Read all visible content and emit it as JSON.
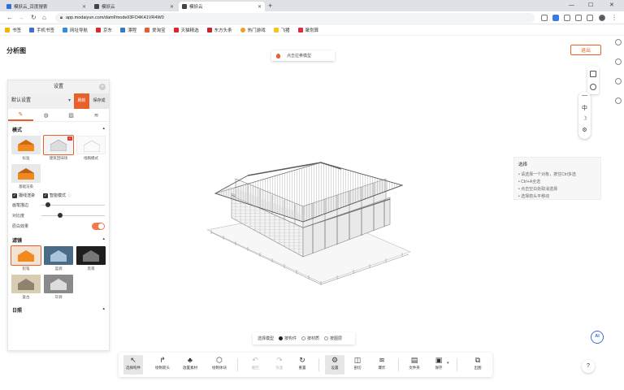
{
  "browser": {
    "tabs": [
      {
        "label": "模妖云_百度搜索",
        "active": false
      },
      {
        "label": "模妖云",
        "active": false
      },
      {
        "label": "模妖云",
        "active": true
      }
    ],
    "new_tab": "+",
    "url": "app.modaiyun.com/damf/model/3FO4K41VR4W0",
    "bookmarks": [
      {
        "label": "书签",
        "color": "#f2b400"
      },
      {
        "label": "手机书签",
        "color": "#3b6fd4"
      },
      {
        "label": "网址导航",
        "color": "#2f8de4"
      },
      {
        "label": "京东",
        "color": "#d92c2c"
      },
      {
        "label": "漂程",
        "color": "#3a77c8"
      },
      {
        "label": "爱淘宝",
        "color": "#ef5a2b"
      },
      {
        "label": "天猫精选",
        "color": "#d9272c"
      },
      {
        "label": "东方头条",
        "color": "#c8262b"
      },
      {
        "label": "热门游戏",
        "color": "#f29b1d"
      },
      {
        "label": "飞猪",
        "color": "#f8c31a"
      },
      {
        "label": "聚划算",
        "color": "#e52b3e"
      }
    ]
  },
  "app": {
    "title": "分析图",
    "exit_label": "退出",
    "hint": "点击拉拳模型",
    "accent": "#e8602c"
  },
  "zoom_tools": {
    "minus": "—",
    "lang": "中",
    "moon": "☽",
    "gear": "⚙"
  },
  "settings": {
    "title": "设置",
    "preset": "默认设置",
    "refresh_label": "刷新",
    "save_label": "保存成",
    "mode_title": "模式",
    "modes": [
      {
        "label": "标准",
        "selected": false,
        "style": "orange"
      },
      {
        "label": "建筑回味场",
        "selected": true,
        "style": "sketch"
      },
      {
        "label": "线稿模式",
        "selected": false,
        "style": "line"
      },
      {
        "label": "基础渲染",
        "selected": false,
        "style": "orange"
      }
    ],
    "checkbox_edge": "摄线渲染",
    "checkbox_smart": "智能模式",
    "slider1_label": "画笔描边",
    "slider1_value": 0.1,
    "slider2_label": "对比度",
    "slider2_value": 0.3,
    "toggle_label": "原白效果",
    "toggle_on": true,
    "filter_title": "滤镜",
    "filters": [
      {
        "label": "铅笔",
        "selected": true,
        "style": "orange"
      },
      {
        "label": "蓝调",
        "selected": false,
        "style": "blue"
      },
      {
        "label": "黑夜",
        "selected": false,
        "style": "dark"
      },
      {
        "label": "复古",
        "selected": false,
        "style": "sepia"
      },
      {
        "label": "灰调",
        "selected": false,
        "style": "gray"
      }
    ],
    "daylight_title": "日照"
  },
  "info": {
    "title": "选择",
    "lines": [
      "• 请选择一个对象，按住Ctrl多选",
      "• Ctrl+A全选",
      "• 点击空白处取消选择",
      "• 选择箭头平移动"
    ]
  },
  "mode_bar": {
    "label": "选择模型",
    "options": [
      {
        "label": "按构件",
        "on": true
      },
      {
        "label": "按材质",
        "on": false
      },
      {
        "label": "按图层",
        "on": false
      }
    ]
  },
  "toolbar": {
    "items": [
      {
        "label": "选择构件",
        "icon": "↖",
        "active": true,
        "disabled": false
      },
      {
        "label": "绘制箭头",
        "icon": "↱",
        "active": false,
        "disabled": false
      },
      {
        "label": "放置素材",
        "icon": "♣",
        "active": false,
        "disabled": false
      },
      {
        "label": "绘制体块",
        "icon": "⬡",
        "active": false,
        "disabled": false
      },
      {
        "label": "撤回",
        "icon": "↶",
        "active": false,
        "disabled": true
      },
      {
        "label": "恢复",
        "icon": "↷",
        "active": false,
        "disabled": true
      },
      {
        "label": "重置",
        "icon": "↻",
        "active": false,
        "disabled": false
      },
      {
        "label": "设置",
        "icon": "⚙",
        "active": true,
        "disabled": false
      },
      {
        "label": "剖切",
        "icon": "◫",
        "active": false,
        "disabled": false
      },
      {
        "label": "爆炸",
        "icon": "≋",
        "active": false,
        "disabled": false
      },
      {
        "label": "文件夹",
        "icon": "▤",
        "active": false,
        "disabled": false
      },
      {
        "label": "保存",
        "icon": "▣",
        "active": false,
        "disabled": false
      },
      {
        "label": "出图",
        "icon": "⧉",
        "active": false,
        "disabled": false
      }
    ]
  },
  "ai_label": "AI",
  "help_label": "?"
}
